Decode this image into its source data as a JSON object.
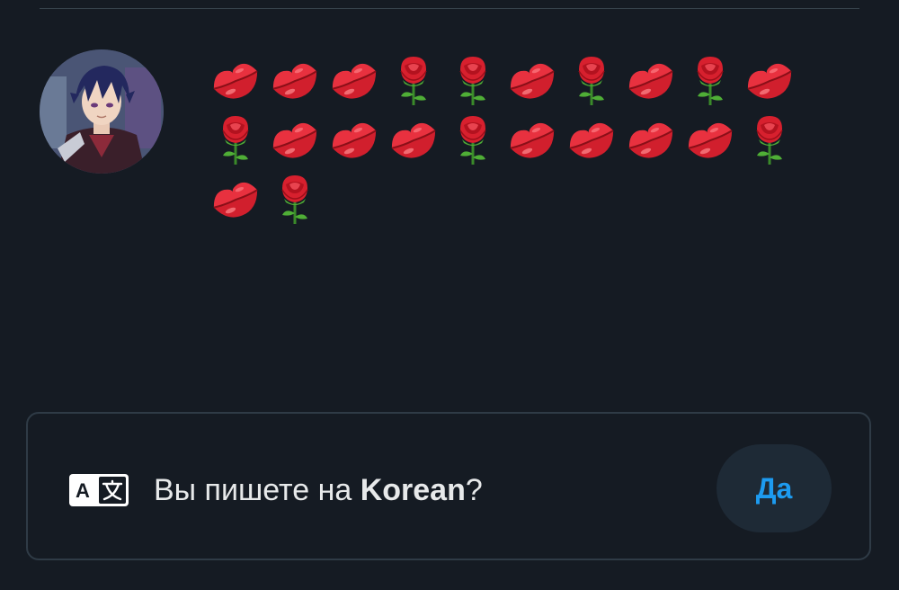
{
  "post": {
    "emoji_sequence": [
      "kiss-mark",
      "kiss-mark",
      "kiss-mark",
      "rose",
      "rose",
      "kiss-mark",
      "rose",
      "kiss-mark",
      "rose",
      "kiss-mark",
      "rose",
      "kiss-mark",
      "kiss-mark",
      "kiss-mark",
      "rose",
      "kiss-mark",
      "kiss-mark",
      "kiss-mark",
      "kiss-mark",
      "rose",
      "kiss-mark",
      "rose"
    ]
  },
  "language_prompt": {
    "question_prefix": "Вы пишете на ",
    "language": "Korean",
    "question_suffix": "?",
    "yes_label": "Да",
    "icon": "translate-icon"
  },
  "colors": {
    "background": "#151b23",
    "accent": "#1d9bf0",
    "border": "#2f3b46"
  }
}
